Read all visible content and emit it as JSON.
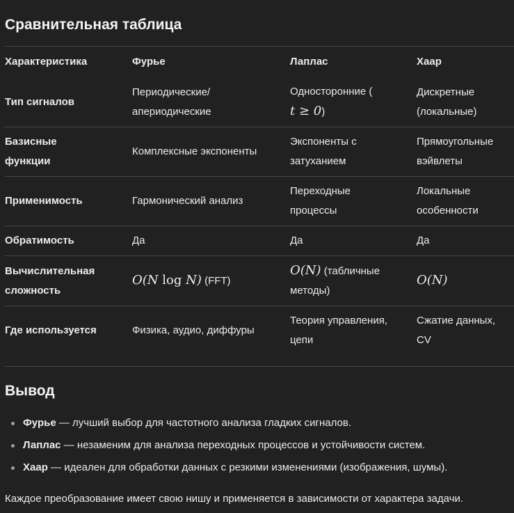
{
  "section_title": "Сравнительная таблица",
  "table": {
    "headers": [
      "Характеристика",
      "Фурье",
      "Лаплас",
      "Хаар"
    ],
    "rows": [
      {
        "label": [
          "Тип сигналов"
        ],
        "cells": [
          [
            "Периодические/",
            "апериодические"
          ],
          [
            "Односторонние (",
            "t ≥ 0)"
          ],
          [
            "Дискретные",
            "(локальные)"
          ]
        ]
      },
      {
        "label": [
          "Базисные",
          "функции"
        ],
        "cells": [
          [
            "Комплексные экспоненты"
          ],
          [
            "Экспоненты с",
            "затуханием"
          ],
          [
            "Прямоугольные",
            "вэйвлеты"
          ]
        ]
      },
      {
        "label": [
          "Применимость"
        ],
        "cells": [
          [
            "Гармонический анализ"
          ],
          [
            "Переходные",
            "процессы"
          ],
          [
            "Локальные",
            "особенности"
          ]
        ]
      },
      {
        "label": [
          "Обратимость"
        ],
        "cells": [
          [
            "Да"
          ],
          [
            "Да"
          ],
          [
            "Да"
          ]
        ]
      },
      {
        "label": [
          "Вычислительная",
          "сложность"
        ],
        "cells": [
          [
            "O(N log N) (FFT)"
          ],
          [
            "O(N) (табличные",
            "методы)"
          ],
          [
            "O(N)"
          ]
        ]
      },
      {
        "label": [
          "Где используется"
        ],
        "cells": [
          [
            "Физика, аудио, диффуры"
          ],
          [
            "Теория управления,",
            "цепи"
          ],
          [
            "Сжатие данных,",
            "CV"
          ]
        ]
      }
    ]
  },
  "math": {
    "t_geq_0": "t ≥ 0",
    "o_nlogn_a": "O(N",
    "o_nlogn_log": "log",
    "o_nlogn_b": "N)",
    "o_n": "O(N)"
  },
  "conclusion_title": "Вывод",
  "bullets": [
    {
      "bold": "Фурье",
      "text": " — лучший выбор для частотного анализа гладких сигналов."
    },
    {
      "bold": "Лаплас",
      "text": " — незаменим для анализа переходных процессов и устойчивости систем."
    },
    {
      "bold": "Хаар",
      "text": " — идеален для обработки данных с резкими изменениями (изображения, шумы)."
    }
  ],
  "final_text": "Каждое преобразование имеет свою нишу и применяется в зависимости от характера задачи."
}
